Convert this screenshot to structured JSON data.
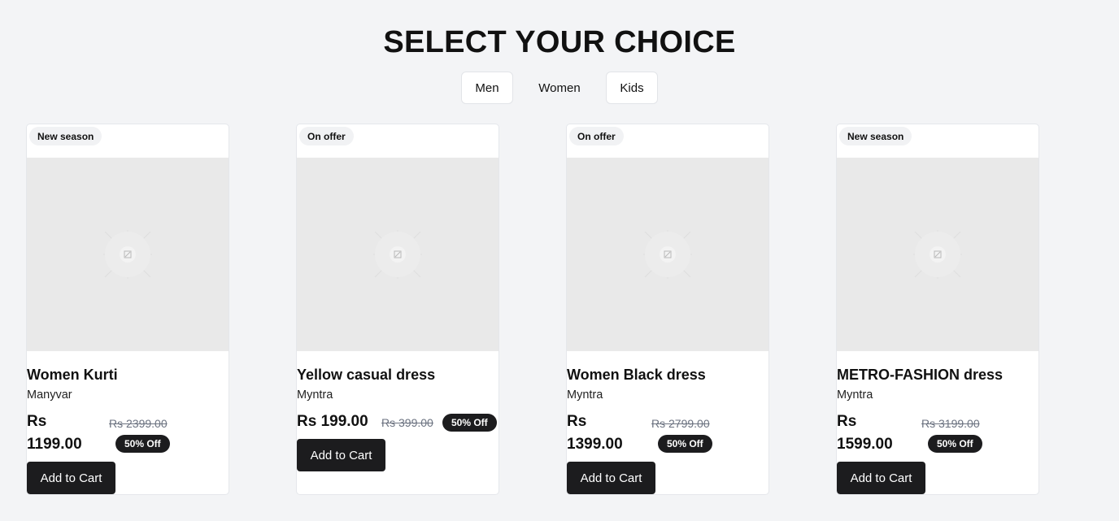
{
  "page": {
    "title": "SELECT YOUR CHOICE"
  },
  "tabs": [
    {
      "label": "Men"
    },
    {
      "label": "Women"
    },
    {
      "label": "Kids"
    }
  ],
  "products": [
    {
      "badge": "New season",
      "name": "Women Kurti",
      "brand": "Manyvar",
      "currency": "Rs",
      "price": "1199.00",
      "old_price": "Rs 2399.00",
      "discount": "50% Off",
      "cta": "Add to Cart"
    },
    {
      "badge": "On offer",
      "name": "Yellow casual dress",
      "brand": "Myntra",
      "price_full": "Rs 199.00",
      "old_price": "Rs 399.00",
      "discount": "50% Off",
      "cta": "Add to Cart"
    },
    {
      "badge": "On offer",
      "name": "Women Black dress",
      "brand": "Myntra",
      "currency": "Rs",
      "price": "1399.00",
      "old_price": "Rs 2799.00",
      "discount": "50% Off",
      "cta": "Add to Cart"
    },
    {
      "badge": "New season",
      "name": "METRO-FASHION dress",
      "brand": "Myntra",
      "currency": "Rs",
      "price": "1599.00",
      "old_price": "Rs 3199.00",
      "discount": "50% Off",
      "cta": "Add to Cart"
    }
  ],
  "icons": {
    "image_placeholder": "image-placeholder-icon"
  },
  "colors": {
    "background": "#f3f4f6",
    "button": "#1c1c1e",
    "badge": "#f1f2f4",
    "placeholder": "#e9e9e9"
  }
}
